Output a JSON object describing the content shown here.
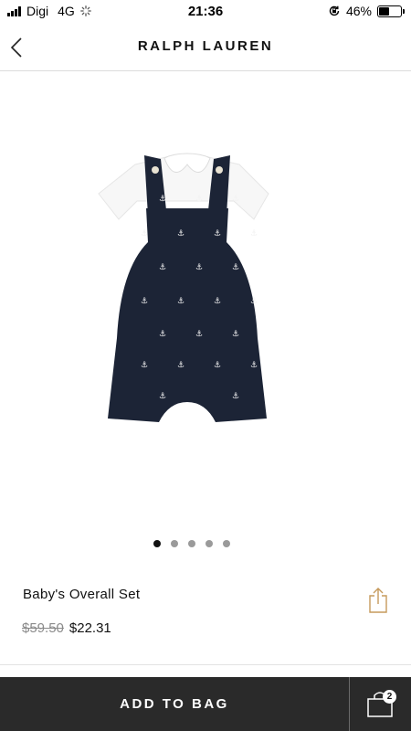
{
  "status_bar": {
    "carrier": "Digi",
    "network": "4G",
    "time": "21:36",
    "battery_percent": "46%",
    "battery_level": 0.46
  },
  "header": {
    "brand": "RALPH LAUREN"
  },
  "product": {
    "name": "Baby's Overall Set",
    "original_price": "$59.50",
    "sale_price": "$22.31",
    "image_description": "navy overall with white collared tee and embroidered anchors"
  },
  "carousel": {
    "total": 5,
    "active_index": 0
  },
  "bottom_bar": {
    "add_to_bag_label": "ADD TO BAG",
    "bag_count": "2"
  },
  "colors": {
    "bottom_bar_bg": "#2a2a2a",
    "share_icon": "#c69a5c",
    "overall_navy": "#1c2436"
  }
}
